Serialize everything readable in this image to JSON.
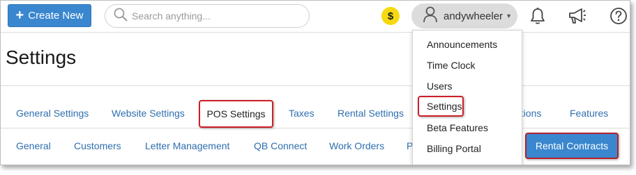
{
  "header": {
    "create_label": "Create New",
    "search_placeholder": "Search anything...",
    "currency_symbol": "$",
    "username": "andywheeler",
    "icons": [
      "search-icon",
      "user-icon",
      "bell-icon",
      "megaphone-icon",
      "help-icon"
    ]
  },
  "page": {
    "title": "Settings"
  },
  "tabs_primary": [
    {
      "label": "General Settings"
    },
    {
      "label": "Website Settings"
    },
    {
      "label": "POS Settings"
    },
    {
      "label": "Taxes"
    },
    {
      "label": "Rental Settings"
    },
    {
      "label": "ations"
    },
    {
      "label": "Features"
    }
  ],
  "tabs_secondary": [
    {
      "label": "General"
    },
    {
      "label": "Customers"
    },
    {
      "label": "Letter Management"
    },
    {
      "label": "QB Connect"
    },
    {
      "label": "Work Orders"
    },
    {
      "label": "P"
    },
    {
      "label": "Rental Contracts"
    }
  ],
  "user_menu": {
    "items": [
      {
        "label": "Announcements"
      },
      {
        "label": "Time Clock"
      },
      {
        "label": "Users"
      },
      {
        "label": "Settings"
      },
      {
        "label": "Beta Features"
      },
      {
        "label": "Billing Portal"
      }
    ]
  },
  "colors": {
    "primary_button": "#3a87cf",
    "link": "#2f6fae",
    "highlight_border": "#cc1f26",
    "currency_badge": "#f6d90f"
  }
}
